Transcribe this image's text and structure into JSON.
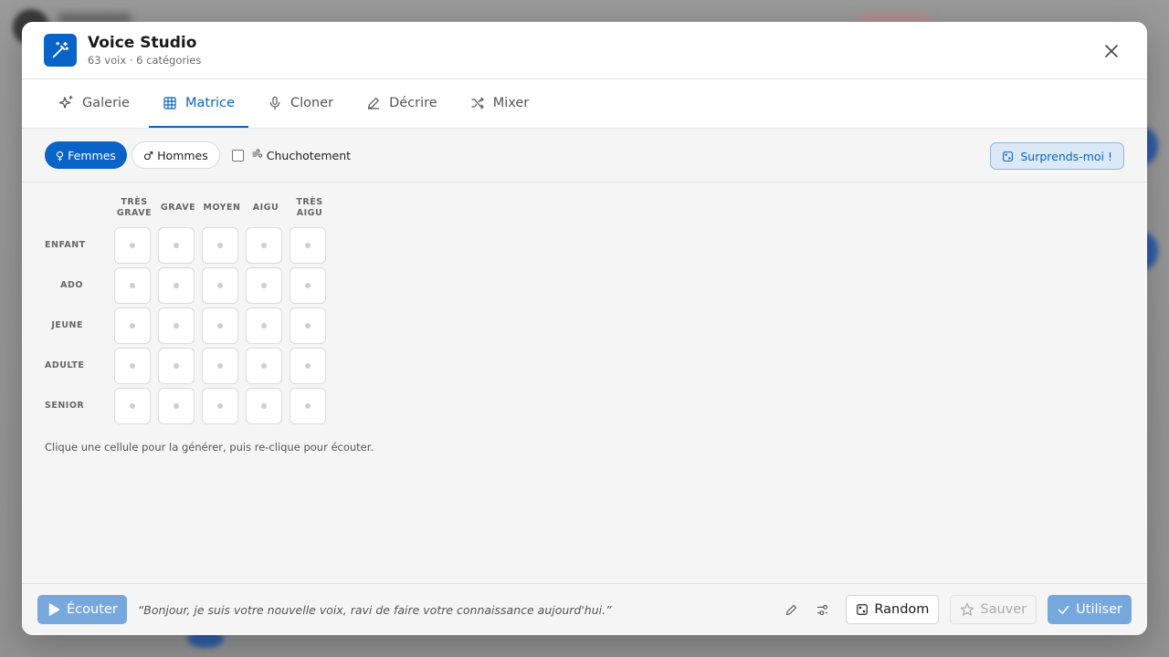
{
  "app": {
    "title": "Voice Studio",
    "subtitle": "63 voix · 6 catégories"
  },
  "tabs": [
    {
      "label": "Galerie",
      "icon": "sparkles-icon",
      "active": false
    },
    {
      "label": "Matrice",
      "icon": "grid-icon",
      "active": true
    },
    {
      "label": "Cloner",
      "icon": "microphone-icon",
      "active": false
    },
    {
      "label": "Décrire",
      "icon": "pencil-icon",
      "active": false
    },
    {
      "label": "Mixer",
      "icon": "shuffle-icon",
      "active": false
    }
  ],
  "filters": {
    "women": {
      "symbol": "♀",
      "label": "Femmes",
      "selected": true
    },
    "men": {
      "symbol": "♂",
      "label": "Hommes",
      "selected": false
    },
    "whisper": {
      "symbol": "🌬",
      "label": "Chuchotement",
      "checked": false
    },
    "surprise_label": "Surprends-moi !"
  },
  "matrix": {
    "columns": [
      {
        "line1": "TRÈS",
        "line2": "GRAVE"
      },
      {
        "line1": "GRAVE",
        "line2": ""
      },
      {
        "line1": "MOYEN",
        "line2": ""
      },
      {
        "line1": "AIGU",
        "line2": ""
      },
      {
        "line1": "TRÈS",
        "line2": "AIGU"
      }
    ],
    "rows": [
      "ENFANT",
      "ADO",
      "JEUNE",
      "ADULTE",
      "SENIOR"
    ],
    "hint": "Clique une cellule pour la générer, puis re-clique pour écouter."
  },
  "footer": {
    "listen_label": "Écouter",
    "preview_text": "“Bonjour, je suis votre nouvelle voix, ravi de faire votre connaissance aujourd'hui.”",
    "random_label": "Random",
    "save_label": "Sauver",
    "use_label": "Utiliser"
  },
  "colors": {
    "accent": "#0a63c7",
    "accent_light": "#77a8dd",
    "surprise_bg": "#dbe8f6"
  }
}
